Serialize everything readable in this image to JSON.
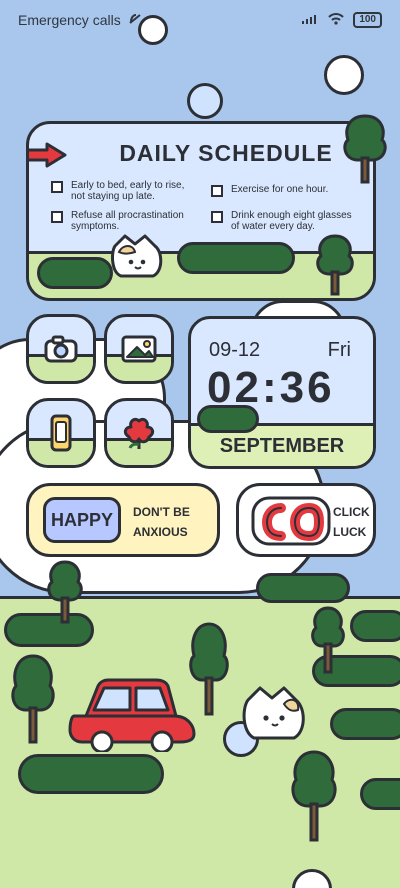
{
  "status": {
    "left": "Emergency calls",
    "battery": "100"
  },
  "schedule": {
    "title": "DAILY SCHEDULE",
    "tasks": [
      "Early to bed, early to rise, not staying up late.",
      "Exercise for one hour.",
      "Refuse all procrastination symptoms.",
      "Drink enough eight glasses of water every day."
    ]
  },
  "clock": {
    "date": "09-12",
    "day": "Fri",
    "time": "02:36",
    "month": "SEPTEMBER"
  },
  "mood": {
    "badge": "HAPPY",
    "line1": "DON'T BE",
    "line2": "ANXIOUS"
  },
  "luck": {
    "line1": "CLICK",
    "line2": "LUCK"
  },
  "colors": {
    "sky": "#a9c7ec",
    "grass": "#cfe8a7",
    "dark_green": "#2f6b3b",
    "outline": "#2c2f35",
    "car_red": "#e43a3f"
  }
}
